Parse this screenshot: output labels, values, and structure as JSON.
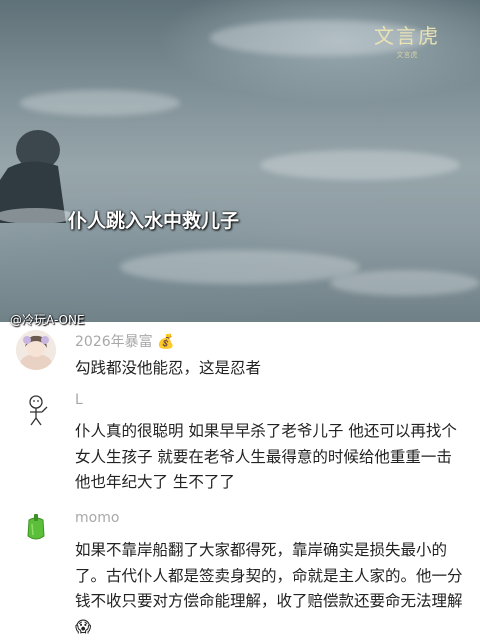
{
  "video": {
    "watermark_title": "文言虎",
    "watermark_sub": "文言虎",
    "subtitle": "仆人跳入水中救儿子",
    "author_handle": "@冷玩A-ONE"
  },
  "comments": [
    {
      "username": "2026年暴富",
      "username_emoji": "💰",
      "text": "勾践都没他能忍，这是忍者"
    },
    {
      "username": "L",
      "text": "仆人真的很聪明 如果早早杀了老爷儿子 他还可以再找个女人生孩子 就要在老爷人生最得意的时候给他重重一击 他也年纪大了 生不了了"
    },
    {
      "username": "momo",
      "text": "如果不靠岸船翻了大家都得死，靠岸确实是损失最小的了。古代仆人都是签卖身契的，命就是主人家的。他一分钱不收只要对方偿命能理解，收了赔偿款还要命无法理解",
      "text_emoji": "😱"
    }
  ],
  "colors": {
    "username": "#a8a8a8",
    "comment_text": "#222222",
    "watermark": "#e8e2b5"
  }
}
